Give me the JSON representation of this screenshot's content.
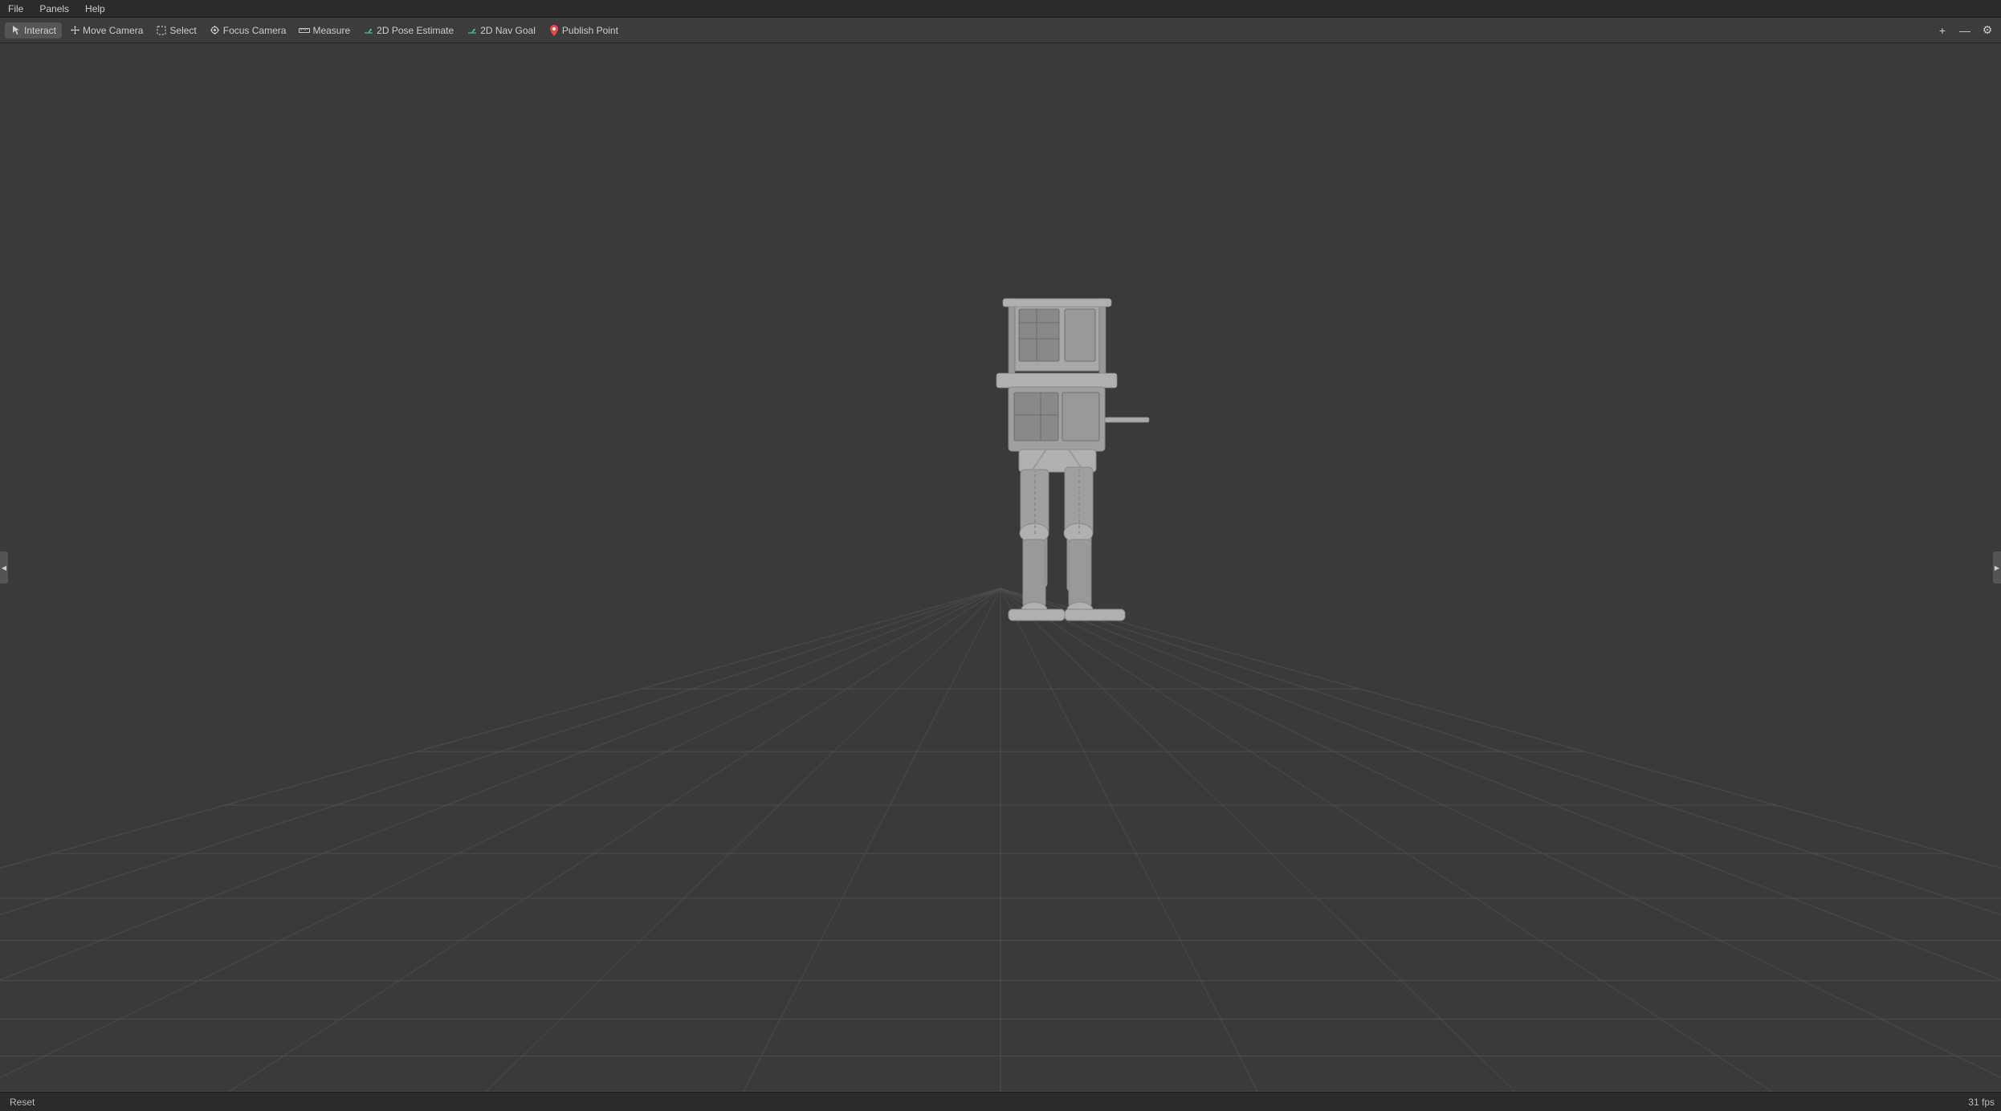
{
  "menubar": {
    "items": [
      {
        "label": "File",
        "id": "menu-file"
      },
      {
        "label": "Panels",
        "id": "menu-panels"
      },
      {
        "label": "Help",
        "id": "menu-help"
      }
    ]
  },
  "toolbar": {
    "tools": [
      {
        "id": "interact",
        "label": "Interact",
        "icon": "cursor",
        "active": true
      },
      {
        "id": "move-camera",
        "label": "Move Camera",
        "icon": "move"
      },
      {
        "id": "select",
        "label": "Select",
        "icon": "select"
      },
      {
        "id": "focus-camera",
        "label": "Focus Camera",
        "icon": "focus"
      },
      {
        "id": "measure",
        "label": "Measure",
        "icon": "ruler"
      },
      {
        "id": "2d-pose-estimate",
        "label": "2D Pose Estimate",
        "icon": "pose"
      },
      {
        "id": "2d-nav-goal",
        "label": "2D Nav Goal",
        "icon": "nav"
      },
      {
        "id": "publish-point",
        "label": "Publish Point",
        "icon": "point"
      }
    ],
    "right_icons": [
      {
        "id": "plus-icon",
        "symbol": "+"
      },
      {
        "id": "minus-icon",
        "symbol": "—"
      },
      {
        "id": "settings-icon",
        "symbol": "⚙"
      }
    ]
  },
  "viewport": {
    "background_color": "#3a3a3a",
    "grid_color": "#555555"
  },
  "statusbar": {
    "reset_label": "Reset",
    "fps": "31 fps"
  },
  "panel_toggle_left": {
    "symbol": "◀"
  },
  "panel_toggle_right": {
    "symbol": "▶"
  }
}
